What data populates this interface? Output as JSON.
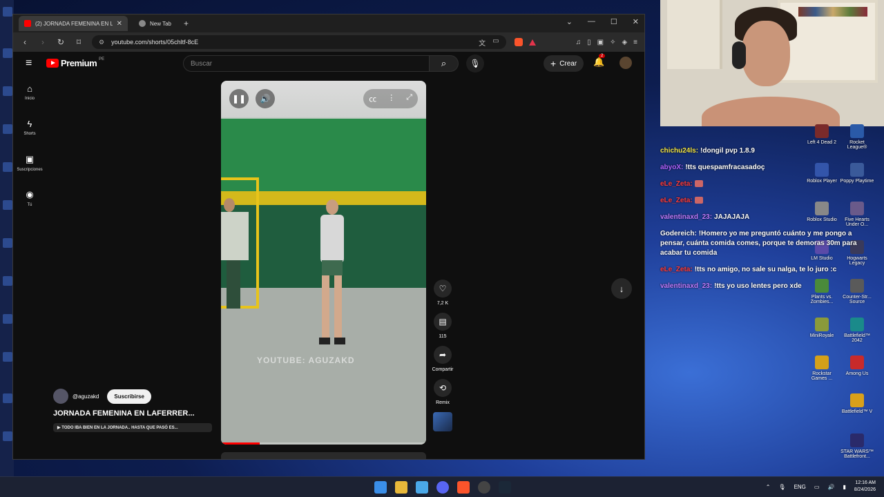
{
  "browser": {
    "tabs": [
      {
        "label": "(2) JORNADA FEMENINA EN L",
        "active": true
      },
      {
        "label": "New Tab",
        "active": false
      }
    ],
    "url": "youtube.com/shorts/05chltf-8cE"
  },
  "youtube": {
    "logo_text": "Premium",
    "region": "PE",
    "search_placeholder": "Buscar",
    "create_label": "Crear",
    "notification_count": "2",
    "sidebar": [
      {
        "label": "Inicio",
        "icon": "home-icon"
      },
      {
        "label": "Shorts",
        "icon": "shorts-icon"
      },
      {
        "label": "Suscripciones",
        "icon": "subscriptions-icon"
      },
      {
        "label": "Tú",
        "icon": "you-icon"
      }
    ],
    "video": {
      "watermark": "YOUTUBE: AGUZAKD",
      "progress_fraction": 0.19
    },
    "actions": [
      {
        "icon": "like-icon",
        "label": "7,2 K"
      },
      {
        "icon": "comment-icon",
        "label": "115"
      },
      {
        "icon": "share-icon",
        "label": "Compartir"
      },
      {
        "icon": "remix-icon",
        "label": "Remix"
      }
    ],
    "channel": "@aguzakd",
    "subscribe_label": "Suscribirse",
    "title": "JORNADA FEMENINA EN LAFERRER...",
    "description": "TODO IBA BIEN EN LA JORNADA.. HASTA QUE PASÓ ES..."
  },
  "chat": [
    {
      "user": "chichu24ls:",
      "text": "!dongil pvp 1.8.9",
      "color": "#f5e642"
    },
    {
      "user": "abyoX:",
      "text": "!tts quespamfracasadoç",
      "color": "#b061ff"
    },
    {
      "user": "eLe_Zeta:",
      "text": "",
      "color": "#ff3b3b"
    },
    {
      "user": "eLe_Zeta:",
      "text": "",
      "color": "#ff3b3b"
    },
    {
      "user": "valentinaxd_23:",
      "text": "JAJAJAJA",
      "color": "#c07bff"
    },
    {
      "user": "Godereich:",
      "text": "!Homero yo me preguntó cuánto y me pongo a pensar, cuánta comida comes, porque te demoras 30m para acabar tu comida",
      "color": "#ffffff"
    },
    {
      "user": "eLe_Zeta:",
      "text": "!tts no amigo, no sale su nalga, te lo juro :c",
      "color": "#ff3b3b"
    },
    {
      "user": "valentinaxd_23:",
      "text": "!tts yo uso lentes pero xde",
      "color": "#c07bff"
    }
  ],
  "desktop_icons": [
    {
      "label": "Left 4 Dead 2",
      "color": "#7a2a2a"
    },
    {
      "label": "Rocket League®",
      "color": "#2a5aa8"
    },
    {
      "label": "Roblox Player",
      "color": "#3355aa"
    },
    {
      "label": "Poppy Playtime",
      "color": "#3a5a9a"
    },
    {
      "label": "Roblox Studio",
      "color": "#888888"
    },
    {
      "label": "Five Hearts Under O...",
      "color": "#6a5a8a"
    },
    {
      "label": "LM Studio",
      "color": "#5a4aa8"
    },
    {
      "label": "Hogwarts Legacy",
      "color": "#3a3a5a"
    },
    {
      "label": "Plants vs. Zombies...",
      "color": "#4a8a3a"
    },
    {
      "label": "Counter-Str... Source",
      "color": "#5a5a5a"
    },
    {
      "label": "MiniRoyale",
      "color": "#8a9a3a"
    },
    {
      "label": "Battlefield™ 2042",
      "color": "#1a8a8a"
    },
    {
      "label": "Rockstar Games ...",
      "color": "#d4a01a"
    },
    {
      "label": "Among Us",
      "color": "#c82a2a"
    },
    {
      "label": "Battlefield™ V",
      "color": "#d8a01a"
    },
    {
      "label": "STAR WARS™ Battlefront...",
      "color": "#2a2a6a"
    }
  ],
  "taskbar": {
    "lang": "ENG",
    "time": "12:16 AM",
    "date": "8/24/2026"
  }
}
